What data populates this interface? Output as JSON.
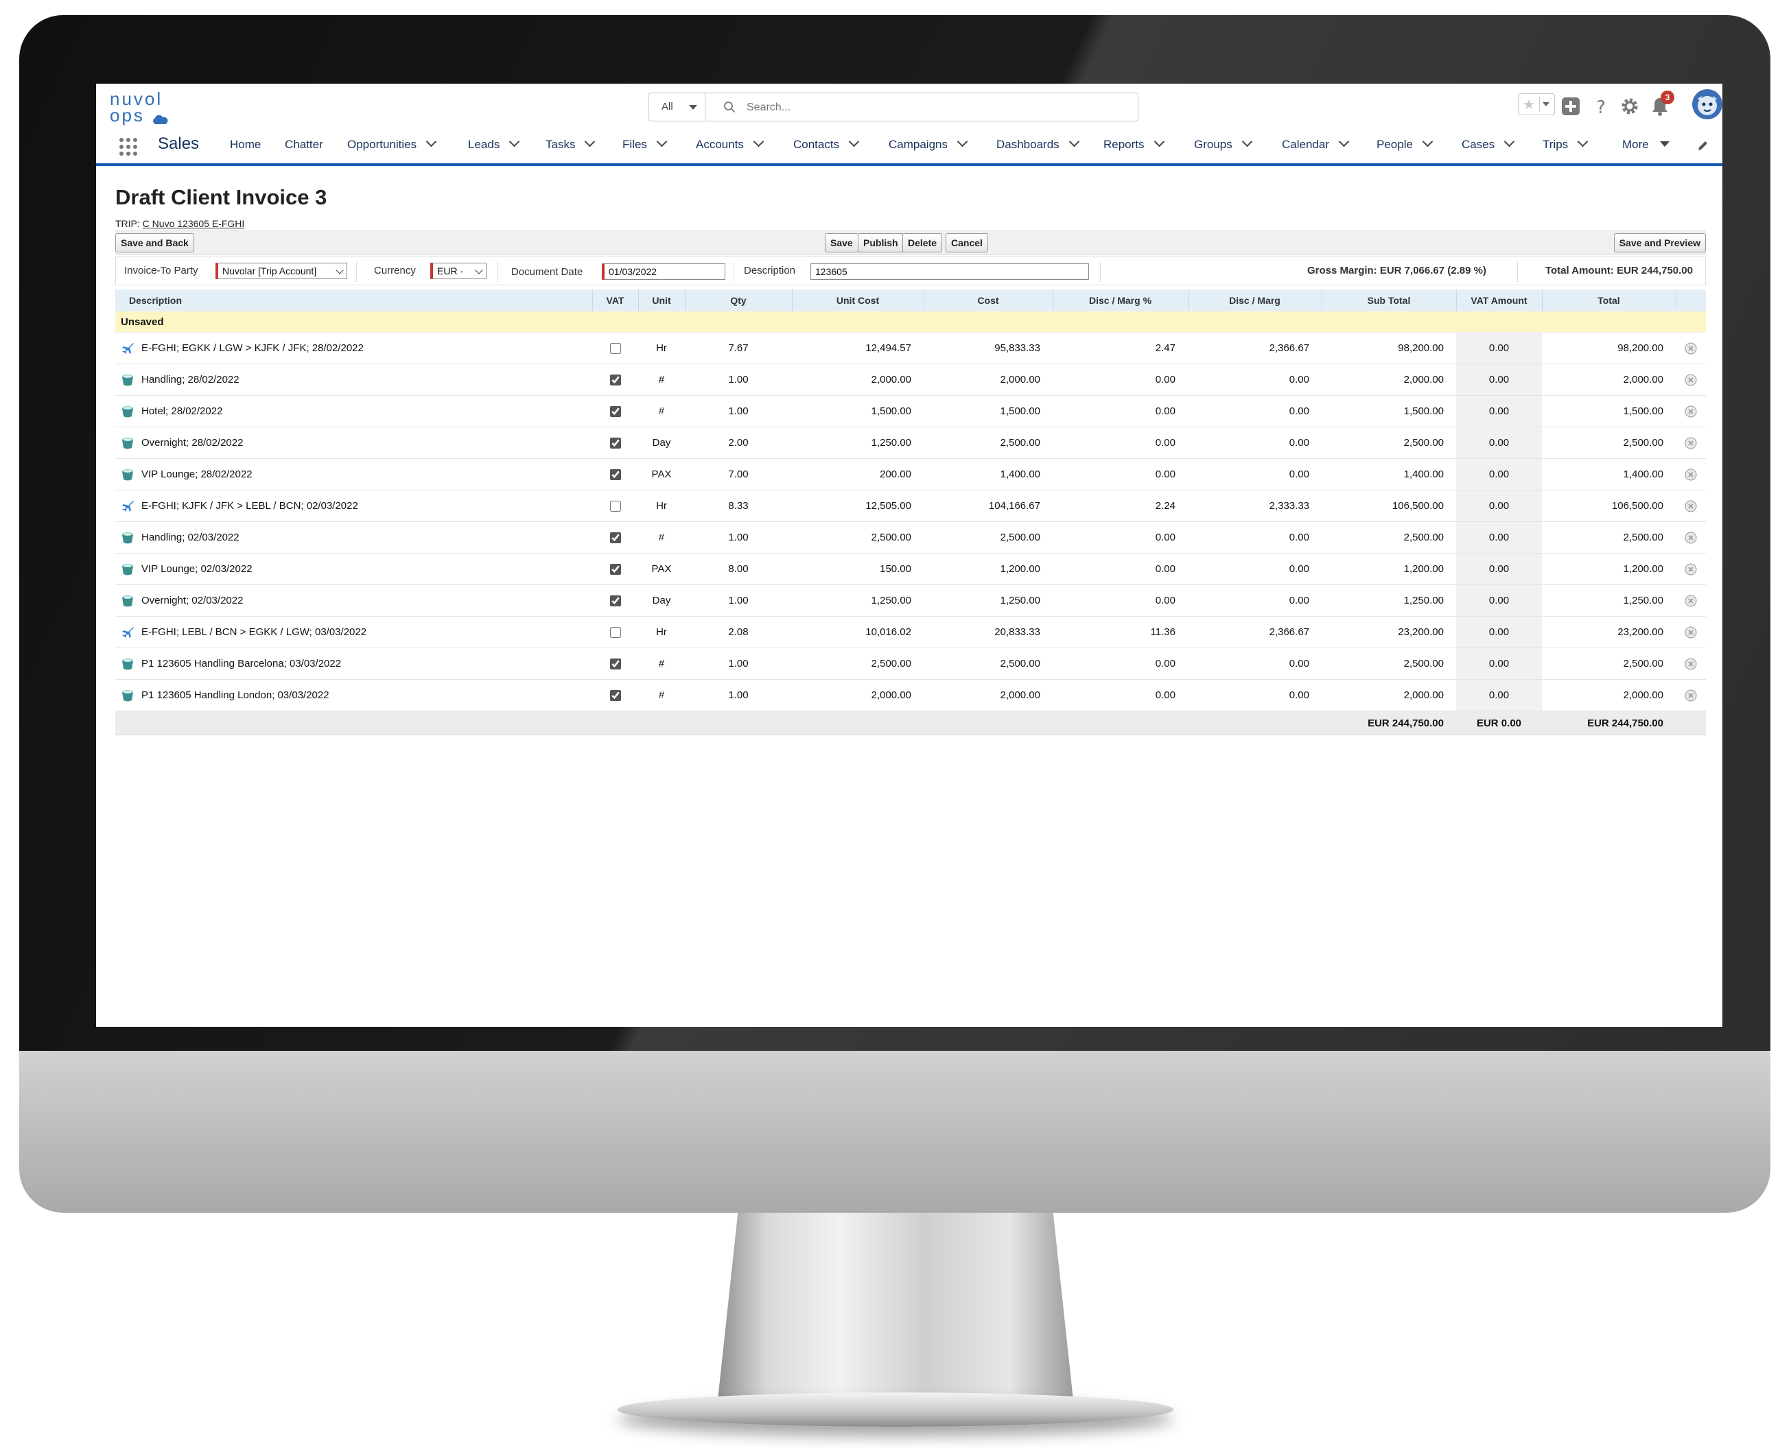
{
  "header": {
    "logo_line1": "nuvol",
    "logo_line2": "ops",
    "search_scope": "All",
    "search_placeholder": "Search...",
    "notification_count": "3"
  },
  "nav": {
    "app_name": "Sales",
    "items": [
      {
        "label": "Home",
        "dropdown": false
      },
      {
        "label": "Chatter",
        "dropdown": false
      },
      {
        "label": "Opportunities",
        "dropdown": true
      },
      {
        "label": "Leads",
        "dropdown": true
      },
      {
        "label": "Tasks",
        "dropdown": true
      },
      {
        "label": "Files",
        "dropdown": true
      },
      {
        "label": "Accounts",
        "dropdown": true
      },
      {
        "label": "Contacts",
        "dropdown": true
      },
      {
        "label": "Campaigns",
        "dropdown": true
      },
      {
        "label": "Dashboards",
        "dropdown": true
      },
      {
        "label": "Reports",
        "dropdown": true
      },
      {
        "label": "Groups",
        "dropdown": true
      },
      {
        "label": "Calendar",
        "dropdown": true
      },
      {
        "label": "People",
        "dropdown": true
      },
      {
        "label": "Cases",
        "dropdown": true
      },
      {
        "label": "Trips",
        "dropdown": true
      },
      {
        "label": "More",
        "dropdown": true
      }
    ]
  },
  "page": {
    "title": "Draft Client Invoice 3",
    "trip_prefix": "TRIP:",
    "trip_link": "C Nuvo 123605 E-FGHI"
  },
  "buttons": {
    "save_and_back": "Save and Back",
    "save": "Save",
    "publish": "Publish",
    "delete": "Delete",
    "cancel": "Cancel",
    "save_and_preview": "Save and Preview"
  },
  "fields": {
    "invoice_to_label": "Invoice-To Party",
    "invoice_to_value": "Nuvolar [Trip Account]",
    "currency_label": "Currency",
    "currency_value": "EUR -",
    "document_date_label": "Document Date",
    "document_date_value": "01/03/2022",
    "description_label": "Description",
    "description_value": "123605",
    "gross_margin": "Gross Margin: EUR 7,066.67 (2.89 %)",
    "total_amount": "Total Amount: EUR 244,750.00"
  },
  "table": {
    "columns": [
      "Description",
      "VAT",
      "Unit",
      "Qty",
      "Unit Cost",
      "Cost",
      "Disc / Marg %",
      "Disc / Marg",
      "Sub Total",
      "VAT Amount",
      "Total"
    ],
    "group_label": "Unsaved",
    "rows": [
      {
        "type": "flight",
        "description": "E-FGHI; EGKK / LGW > KJFK / JFK; 28/02/2022",
        "vat": false,
        "unit": "Hr",
        "qty": "7.67",
        "unit_cost": "12,494.57",
        "cost": "95,833.33",
        "disc_pct": "2.47",
        "disc": "2,366.67",
        "sub_total": "98,200.00",
        "vat_amount": "0.00",
        "total": "98,200.00"
      },
      {
        "type": "service",
        "description": "Handling; 28/02/2022",
        "vat": true,
        "unit": "#",
        "qty": "1.00",
        "unit_cost": "2,000.00",
        "cost": "2,000.00",
        "disc_pct": "0.00",
        "disc": "0.00",
        "sub_total": "2,000.00",
        "vat_amount": "0.00",
        "total": "2,000.00"
      },
      {
        "type": "service",
        "description": "Hotel; 28/02/2022",
        "vat": true,
        "unit": "#",
        "qty": "1.00",
        "unit_cost": "1,500.00",
        "cost": "1,500.00",
        "disc_pct": "0.00",
        "disc": "0.00",
        "sub_total": "1,500.00",
        "vat_amount": "0.00",
        "total": "1,500.00"
      },
      {
        "type": "service",
        "description": "Overnight; 28/02/2022",
        "vat": true,
        "unit": "Day",
        "qty": "2.00",
        "unit_cost": "1,250.00",
        "cost": "2,500.00",
        "disc_pct": "0.00",
        "disc": "0.00",
        "sub_total": "2,500.00",
        "vat_amount": "0.00",
        "total": "2,500.00"
      },
      {
        "type": "service",
        "description": "VIP Lounge; 28/02/2022",
        "vat": true,
        "unit": "PAX",
        "qty": "7.00",
        "unit_cost": "200.00",
        "cost": "1,400.00",
        "disc_pct": "0.00",
        "disc": "0.00",
        "sub_total": "1,400.00",
        "vat_amount": "0.00",
        "total": "1,400.00"
      },
      {
        "type": "flight",
        "description": "E-FGHI; KJFK / JFK > LEBL / BCN; 02/03/2022",
        "vat": false,
        "unit": "Hr",
        "qty": "8.33",
        "unit_cost": "12,505.00",
        "cost": "104,166.67",
        "disc_pct": "2.24",
        "disc": "2,333.33",
        "sub_total": "106,500.00",
        "vat_amount": "0.00",
        "total": "106,500.00"
      },
      {
        "type": "service",
        "description": "Handling; 02/03/2022",
        "vat": true,
        "unit": "#",
        "qty": "1.00",
        "unit_cost": "2,500.00",
        "cost": "2,500.00",
        "disc_pct": "0.00",
        "disc": "0.00",
        "sub_total": "2,500.00",
        "vat_amount": "0.00",
        "total": "2,500.00"
      },
      {
        "type": "service",
        "description": "VIP Lounge; 02/03/2022",
        "vat": true,
        "unit": "PAX",
        "qty": "8.00",
        "unit_cost": "150.00",
        "cost": "1,200.00",
        "disc_pct": "0.00",
        "disc": "0.00",
        "sub_total": "1,200.00",
        "vat_amount": "0.00",
        "total": "1,200.00"
      },
      {
        "type": "service",
        "description": "Overnight; 02/03/2022",
        "vat": true,
        "unit": "Day",
        "qty": "1.00",
        "unit_cost": "1,250.00",
        "cost": "1,250.00",
        "disc_pct": "0.00",
        "disc": "0.00",
        "sub_total": "1,250.00",
        "vat_amount": "0.00",
        "total": "1,250.00"
      },
      {
        "type": "flight",
        "description": "E-FGHI; LEBL / BCN > EGKK / LGW; 03/03/2022",
        "vat": false,
        "unit": "Hr",
        "qty": "2.08",
        "unit_cost": "10,016.02",
        "cost": "20,833.33",
        "disc_pct": "11.36",
        "disc": "2,366.67",
        "sub_total": "23,200.00",
        "vat_amount": "0.00",
        "total": "23,200.00"
      },
      {
        "type": "service",
        "description": "P1 123605 Handling Barcelona; 03/03/2022",
        "vat": true,
        "unit": "#",
        "qty": "1.00",
        "unit_cost": "2,500.00",
        "cost": "2,500.00",
        "disc_pct": "0.00",
        "disc": "0.00",
        "sub_total": "2,500.00",
        "vat_amount": "0.00",
        "total": "2,500.00"
      },
      {
        "type": "service",
        "description": "P1 123605 Handling London; 03/03/2022",
        "vat": true,
        "unit": "#",
        "qty": "1.00",
        "unit_cost": "2,000.00",
        "cost": "2,000.00",
        "disc_pct": "0.00",
        "disc": "0.00",
        "sub_total": "2,000.00",
        "vat_amount": "0.00",
        "total": "2,000.00"
      }
    ],
    "totals": {
      "sub_total": "EUR 244,750.00",
      "vat_amount": "EUR 0.00",
      "total": "EUR 244,750.00"
    }
  },
  "icons": {
    "flight_row": "airplane-icon",
    "service_row": "cup-icon",
    "remove": "remove-circle-icon",
    "app_launcher": "waffle-grid-icon"
  },
  "colors": {
    "brand": "#2e6fb7",
    "nav_underline": "#1b5fb8",
    "header_row": "#e3eef7",
    "unsaved_row": "#fdf6c4",
    "required_marker": "#c23934",
    "flight_icon": "#2f7fd6",
    "service_icon": "#3a8f8c"
  }
}
